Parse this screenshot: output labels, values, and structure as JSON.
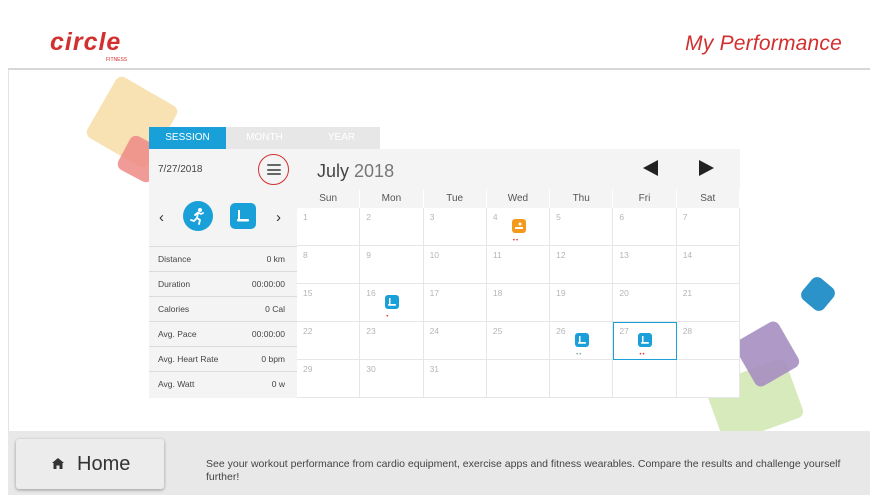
{
  "header": {
    "brand_logo_text": "circle",
    "brand_logo_subtext": "FITNESS",
    "title": "My Performance"
  },
  "tabs": [
    {
      "label": "SESSION",
      "active": true
    },
    {
      "label": "MONTH",
      "active": false
    },
    {
      "label": "YEAR",
      "active": false
    }
  ],
  "session": {
    "date": "7/27/2018",
    "icons": [
      "menu-icon",
      "chevron-left-icon",
      "runner-icon",
      "treadmill-icon",
      "chevron-right-icon"
    ],
    "stats": [
      {
        "label": "Distance",
        "value": "0 km"
      },
      {
        "label": "Duration",
        "value": "00:00:00"
      },
      {
        "label": "Calories",
        "value": "0 Cal"
      },
      {
        "label": "Avg. Pace",
        "value": "00:00:00"
      },
      {
        "label": "Avg. Heart Rate",
        "value": "0 bpm"
      },
      {
        "label": "Avg. Watt",
        "value": "0 w"
      }
    ]
  },
  "calendar": {
    "month": "July",
    "year": "2018",
    "weekdays": [
      "Sun",
      "Mon",
      "Tue",
      "Wed",
      "Thu",
      "Fri",
      "Sat"
    ],
    "days": [
      "1",
      "2",
      "3",
      "4",
      "5",
      "6",
      "7",
      "8",
      "9",
      "10",
      "11",
      "12",
      "13",
      "14",
      "15",
      "16",
      "17",
      "18",
      "19",
      "20",
      "21",
      "22",
      "23",
      "24",
      "25",
      "26",
      "27",
      "28",
      "29",
      "30",
      "31"
    ],
    "selected_day": "27",
    "events": [
      {
        "day": "4",
        "type": "orange",
        "icon": "workout-app-icon",
        "dots": "••",
        "dot_color": "#e53935"
      },
      {
        "day": "16",
        "type": "blue",
        "icon": "treadmill-icon",
        "dots": "•",
        "dot_color": "#e53935"
      },
      {
        "day": "26",
        "type": "blue",
        "icon": "treadmill-icon",
        "dots": "••",
        "dot_color": "#90a4ae"
      },
      {
        "day": "27",
        "type": "blue",
        "icon": "treadmill-icon",
        "dots": "••",
        "dot_color": "#e53935"
      }
    ]
  },
  "footer": {
    "home_label": "Home",
    "description": "See your workout performance from cardio equipment, exercise apps and fitness wearables. Compare the results and challenge yourself further!"
  },
  "colors": {
    "brand_red": "#d32f2f",
    "accent_blue": "#1aa0d8",
    "event_orange": "#f39a1c"
  }
}
